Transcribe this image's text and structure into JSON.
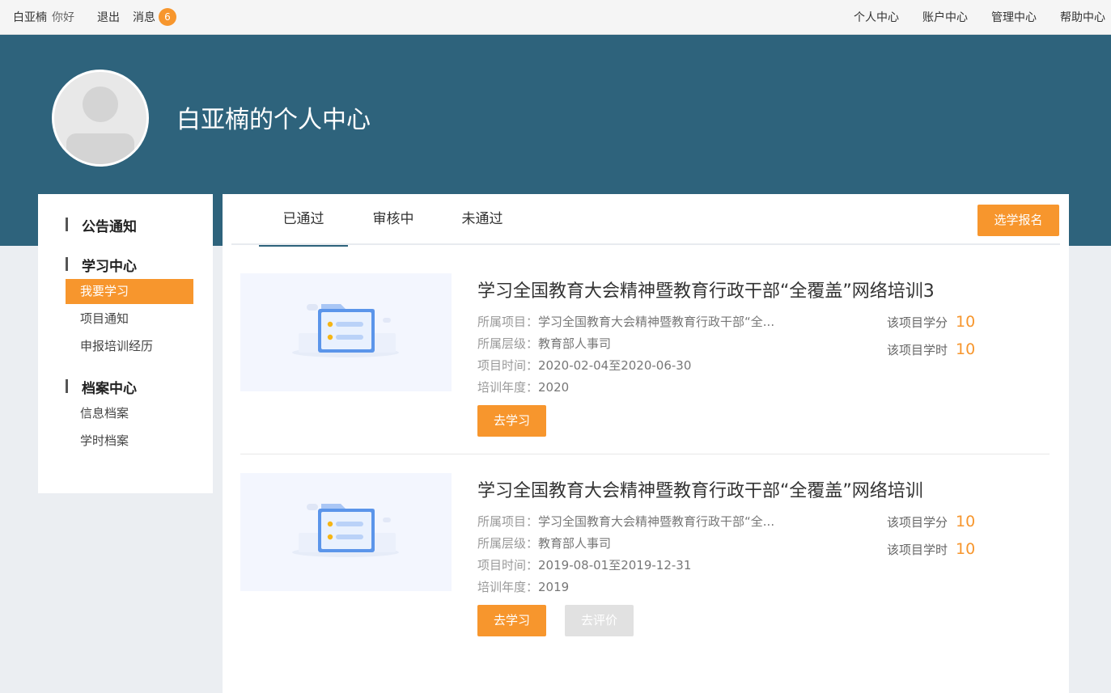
{
  "topbar": {
    "username": "白亚楠",
    "greeting": "你好",
    "logout": "退出",
    "messages_label": "消息",
    "messages_count": "6",
    "nav": [
      "个人中心",
      "账户中心",
      "管理中心",
      "帮助中心"
    ]
  },
  "banner": {
    "title": "白亚楠的个人中心"
  },
  "sidebar": {
    "groups": [
      {
        "title": "公告通知",
        "items": []
      },
      {
        "title": "学习中心",
        "items": [
          "我要学习",
          "项目通知",
          "申报培训经历"
        ]
      },
      {
        "title": "档案中心",
        "items": [
          "信息档案",
          "学时档案"
        ]
      }
    ],
    "active_item": "我要学习"
  },
  "tabs": [
    "已通过",
    "审核中",
    "未通过"
  ],
  "active_tab": "已通过",
  "enroll_button": "选学报名",
  "field_labels": {
    "project": "所属项目：",
    "level": "所属层级：",
    "time": "项目时间：",
    "year": "培训年度：",
    "credit": "该项目学分",
    "hours": "该项目学时"
  },
  "courses": [
    {
      "title": "学习全国教育大会精神暨教育行政干部“全覆盖”网络培训3",
      "project": "学习全国教育大会精神暨教育行政干部“全...",
      "level": "教育部人事司",
      "time": "2020-02-04至2020-06-30",
      "year": "2020",
      "credit": "10",
      "hours": "10",
      "learn_button": "去学习"
    },
    {
      "title": "学习全国教育大会精神暨教育行政干部“全覆盖”网络培训",
      "project": "学习全国教育大会精神暨教育行政干部“全...",
      "level": "教育部人事司",
      "time": "2019-08-01至2019-12-31",
      "year": "2019",
      "credit": "10",
      "hours": "10",
      "learn_button": "去学习",
      "eval_button": "去评价"
    }
  ],
  "colors": {
    "accent": "#f7962d",
    "banner": "#2e637c"
  }
}
